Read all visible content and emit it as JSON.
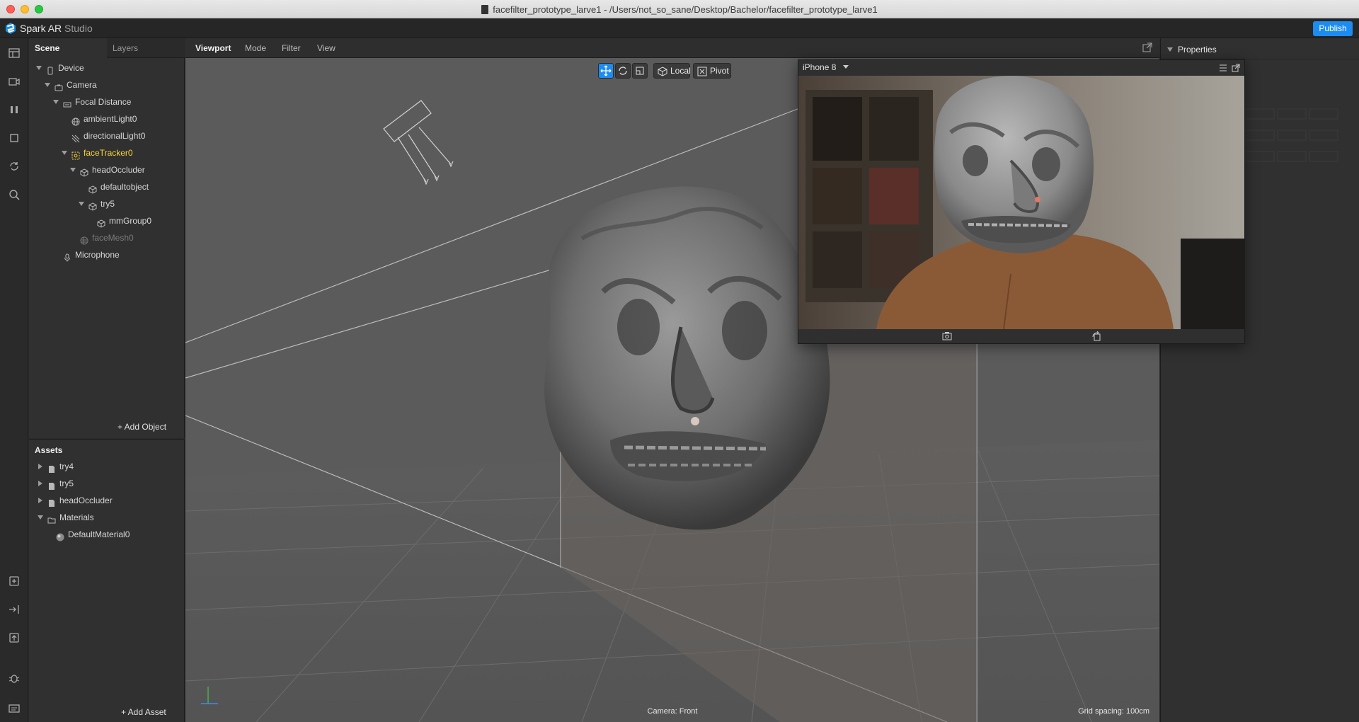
{
  "window": {
    "title": "facefilter_prototype_larve1 - /Users/not_so_sane/Desktop/Bachelor/facefilter_prototype_larve1"
  },
  "app": {
    "name_primary": "Spark AR",
    "name_secondary": "Studio",
    "publish_label": "Publish",
    "accent_color": "#1d8cf0"
  },
  "rail": {
    "icons": [
      "layout-icon",
      "video-icon",
      "pause-icon",
      "stop-icon",
      "refresh-icon",
      "search-icon",
      "add-file-icon",
      "import-icon",
      "export-icon",
      "bug-icon",
      "console-icon"
    ]
  },
  "scene_panel": {
    "tabs": [
      {
        "label": "Scene",
        "active": true
      },
      {
        "label": "Layers",
        "active": false
      }
    ],
    "tree": [
      {
        "label": "Device",
        "depth": 0,
        "icon": "device-icon",
        "expanded": true
      },
      {
        "label": "Camera",
        "depth": 1,
        "icon": "camera-icon",
        "expanded": true
      },
      {
        "label": "Focal Distance",
        "depth": 2,
        "icon": "focal-distance-icon",
        "expanded": true
      },
      {
        "label": "ambientLight0",
        "depth": 3,
        "icon": "globe-icon"
      },
      {
        "label": "directionalLight0",
        "depth": 3,
        "icon": "directional-light-icon"
      },
      {
        "label": "faceTracker0",
        "depth": 3,
        "icon": "face-tracker-icon",
        "expanded": true,
        "highlight": "#f5d43d"
      },
      {
        "label": "headOccluder",
        "depth": 4,
        "icon": "cube-icon",
        "expanded": true
      },
      {
        "label": "defaultobject",
        "depth": 5,
        "icon": "cube-icon"
      },
      {
        "label": "try5",
        "depth": 5,
        "icon": "cube-icon",
        "expanded": true
      },
      {
        "label": "mmGroup0",
        "depth": 6,
        "icon": "cube-icon"
      },
      {
        "label": "faceMesh0",
        "depth": 4,
        "icon": "face-mesh-icon",
        "dim": true
      },
      {
        "label": "Microphone",
        "depth": 2,
        "icon": "microphone-icon"
      }
    ],
    "add_object_label": "+ Add Object"
  },
  "assets_panel": {
    "title": "Assets",
    "items": [
      {
        "label": "try4",
        "depth": 0,
        "icon": "file-icon",
        "expanded": false
      },
      {
        "label": "try5",
        "depth": 0,
        "icon": "file-icon",
        "expanded": false
      },
      {
        "label": "headOccluder",
        "depth": 0,
        "icon": "file-icon",
        "expanded": false
      },
      {
        "label": "Materials",
        "depth": 0,
        "icon": "folder-icon",
        "expanded": true
      },
      {
        "label": "DefaultMaterial0",
        "depth": 1,
        "icon": "material-sphere-icon"
      }
    ],
    "add_asset_label": "+ Add Asset"
  },
  "viewport": {
    "tabs": [
      {
        "label": "Viewport",
        "active": true
      },
      {
        "label": "Mode"
      },
      {
        "label": "Filter"
      },
      {
        "label": "View"
      }
    ],
    "toolbar": {
      "transform_tools": [
        "move-icon",
        "rotate-icon",
        "scale-icon"
      ],
      "local_label": "Local",
      "pivot_label": "Pivot"
    },
    "camera_label": "Camera: Front",
    "grid_label": "Grid spacing: 100cm"
  },
  "preview": {
    "device": "iPhone 8"
  },
  "properties": {
    "title": "Properties"
  }
}
